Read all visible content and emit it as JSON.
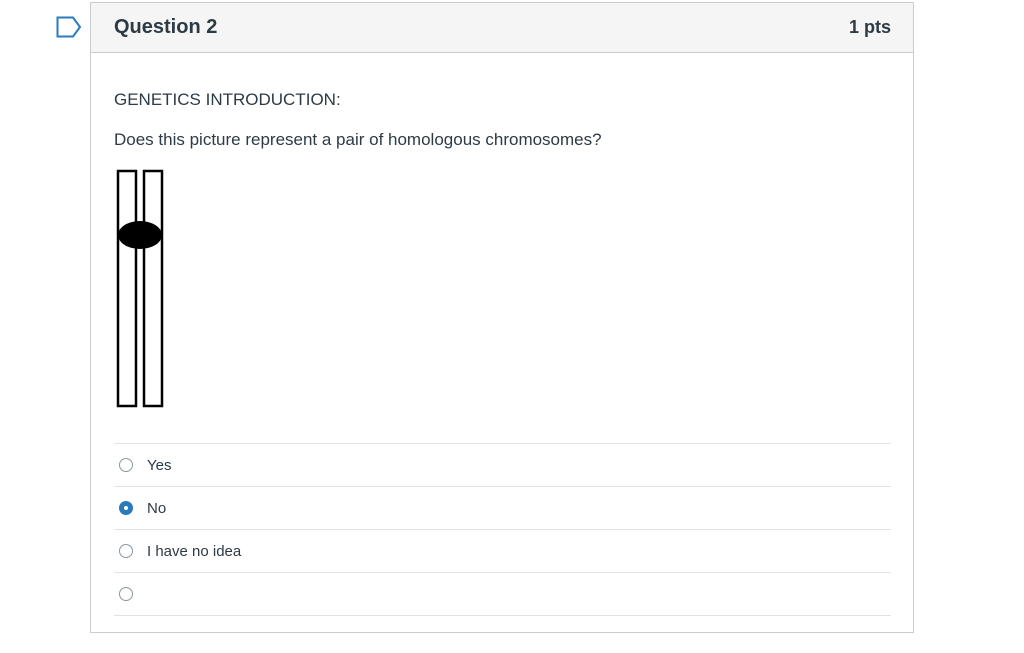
{
  "question": {
    "title": "Question 2",
    "points": "1 pts",
    "intro": "GENETICS INTRODUCTION:",
    "prompt": "Does this picture represent a pair of homologous chromosomes?"
  },
  "figure": {
    "icon": "chromosome-diagram-icon"
  },
  "answers": [
    {
      "label": "Yes",
      "selected": false
    },
    {
      "label": "No",
      "selected": true
    },
    {
      "label": "I have no idea",
      "selected": false
    },
    {
      "label": "",
      "selected": false
    }
  ],
  "colors": {
    "accent": "#2b7abc",
    "flag": "#2b7abc",
    "header_bg": "#f5f5f5",
    "border": "#c7cdd1"
  }
}
